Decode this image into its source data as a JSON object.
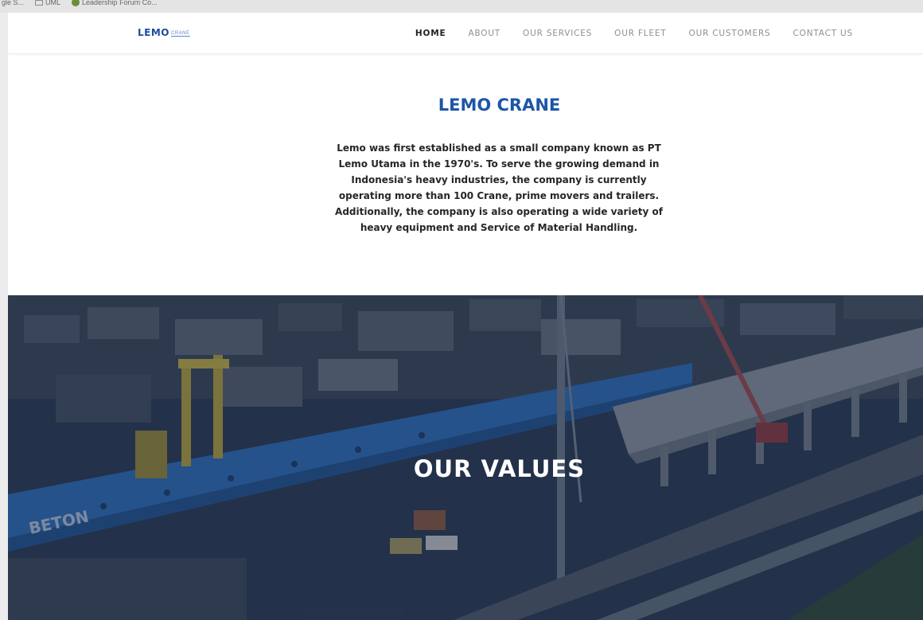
{
  "browser": {
    "bookmarks": [
      {
        "label": "gle S..."
      },
      {
        "label": "UML"
      },
      {
        "label": "Leadership Forum Co..."
      }
    ]
  },
  "navbar": {
    "logo_text": "LEMO",
    "logo_sub": "CRANE",
    "items": [
      {
        "label": "HOME",
        "active": true
      },
      {
        "label": "ABOUT"
      },
      {
        "label": "OUR SERVICES"
      },
      {
        "label": "OUR FLEET"
      },
      {
        "label": "OUR CUSTOMERS"
      },
      {
        "label": "CONTACT US"
      }
    ]
  },
  "intro": {
    "title": "LEMO CRANE",
    "text": "Lemo was first established as a small company known as PT Lemo Utama in the 1970's. To serve the growing demand in Indonesia's heavy industries, the company is currently operating more than 100 Crane, prime movers and trailers. Additionally, the company is also operating a wide variety of heavy equipment and Service of Material Handling."
  },
  "hero": {
    "title": "OUR VALUES",
    "girder_text": "BETON"
  },
  "colors": {
    "brand_blue": "#1d56a8",
    "hero_overlay": "#182642"
  }
}
